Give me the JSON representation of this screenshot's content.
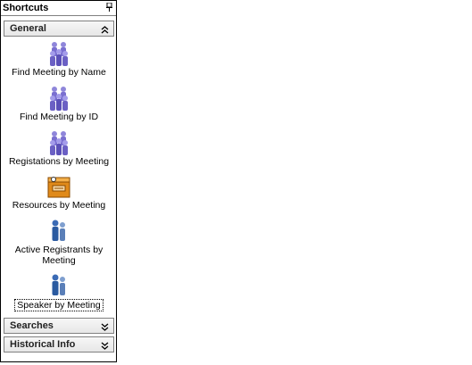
{
  "panel": {
    "title": "Shortcuts",
    "pin_icon": "pin-icon"
  },
  "sections": [
    {
      "label": "General",
      "state": "expanded",
      "icon": "chevron-up-double-icon"
    },
    {
      "label": "Searches",
      "state": "collapsed",
      "icon": "chevron-down-double-icon"
    },
    {
      "label": "Historical Info",
      "state": "collapsed",
      "icon": "chevron-down-double-icon"
    }
  ],
  "general_items": [
    {
      "label": "Find Meeting by Name",
      "icon": "people-group-icon"
    },
    {
      "label": "Find Meeting by ID",
      "icon": "people-group-icon"
    },
    {
      "label": "Registations by Meeting",
      "icon": "people-group-icon"
    },
    {
      "label": "Resources by Meeting",
      "icon": "resources-box-icon"
    },
    {
      "label": "Active Registrants by Meeting",
      "icon": "people-pair-icon"
    },
    {
      "label": "Speaker by Meeting",
      "icon": "people-pair-icon"
    }
  ],
  "colors": {
    "people_purple": "#7a6fd0",
    "people_blue": "#2a5aa0",
    "box_orange": "#e08a1a"
  }
}
